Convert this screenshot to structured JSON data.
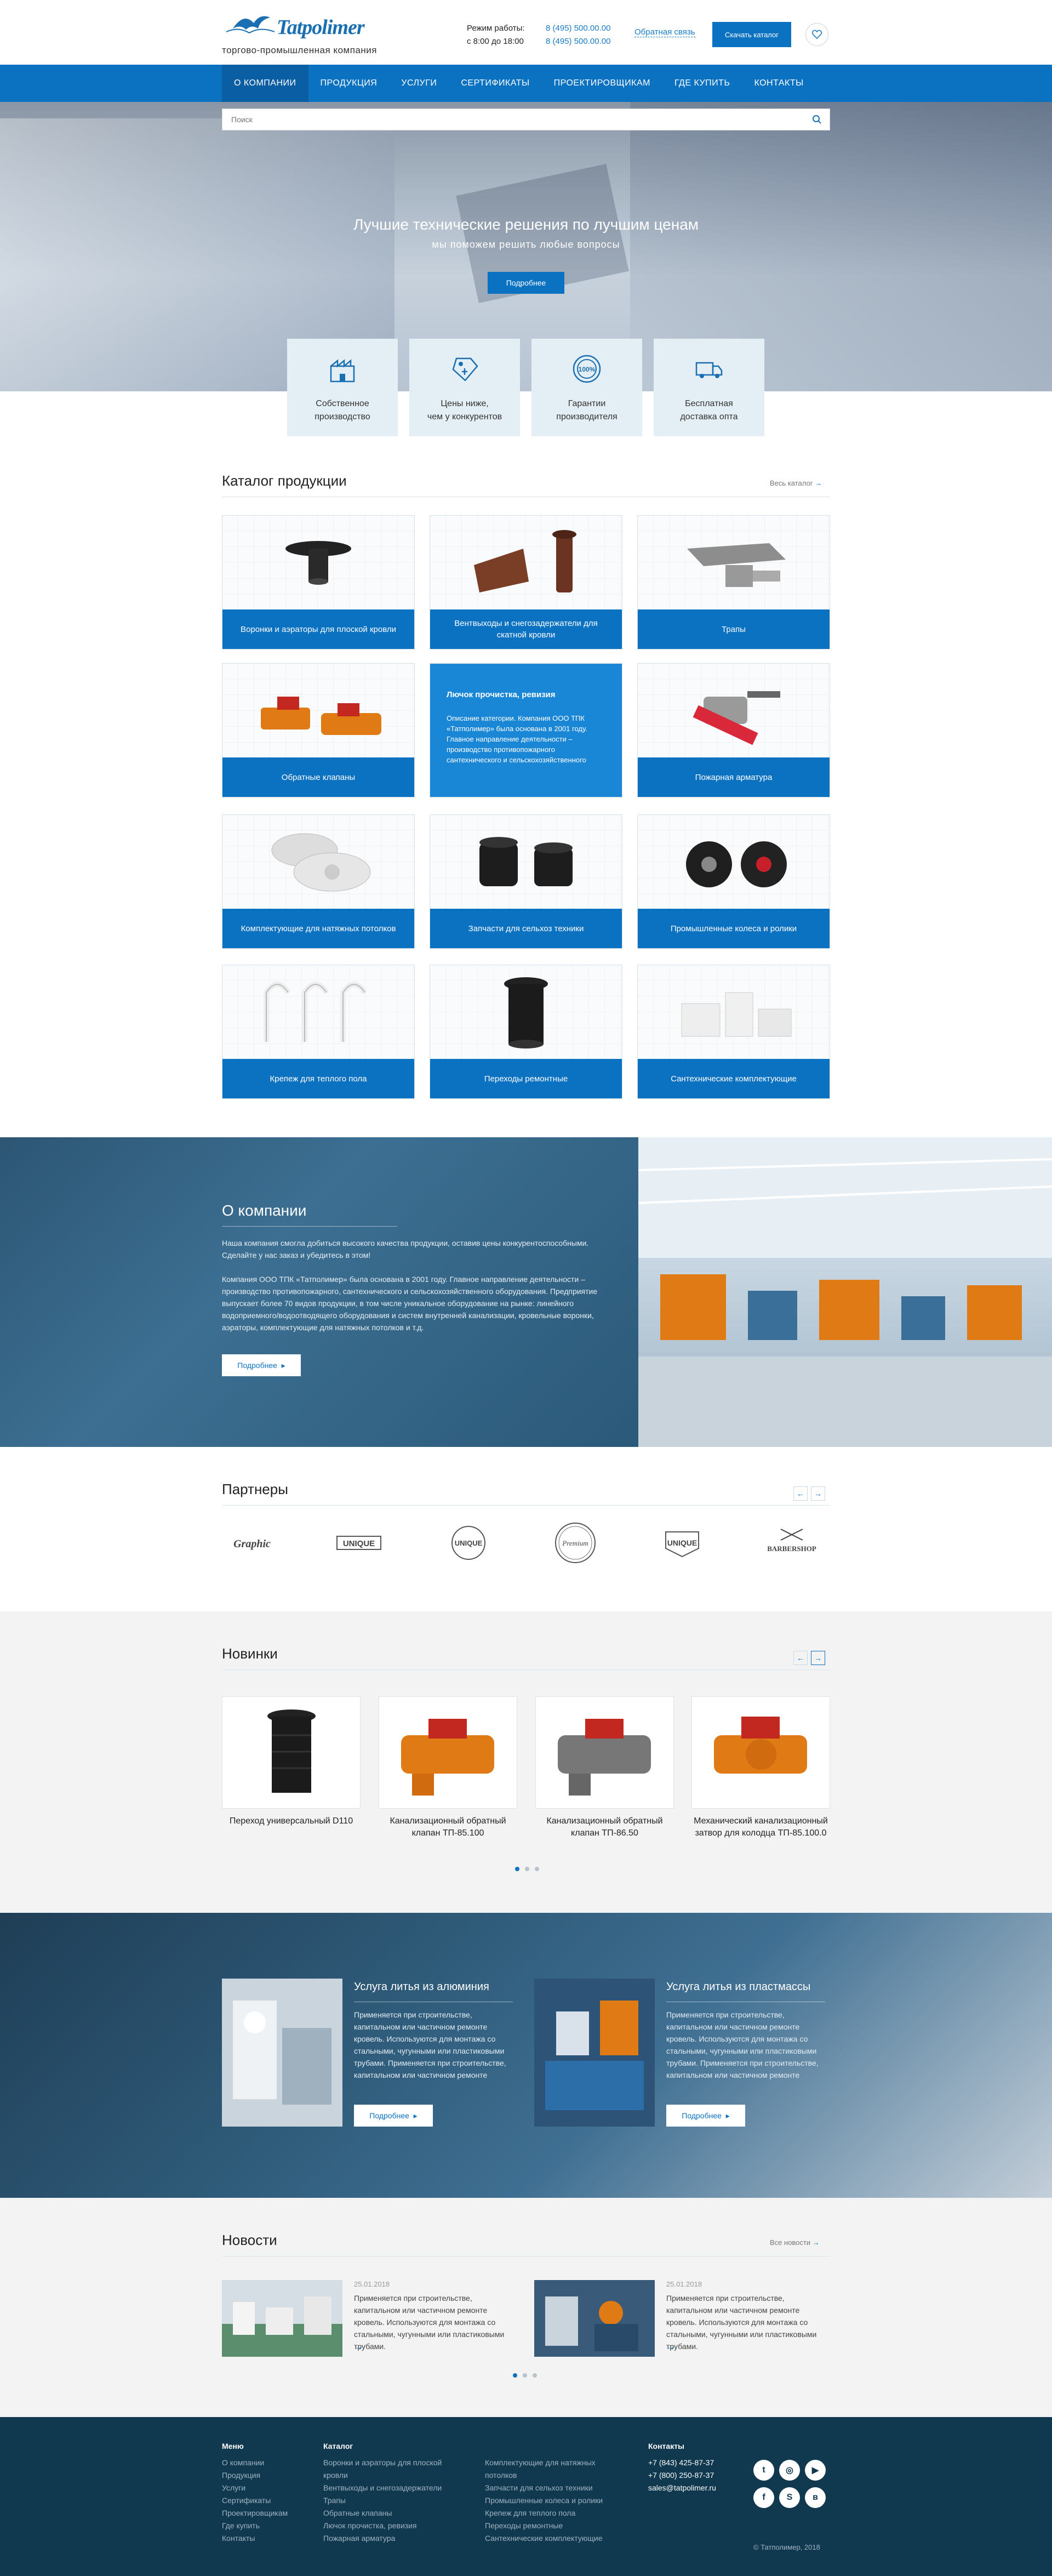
{
  "header": {
    "logo_text": "Tatpolimer",
    "tagline": "торгово-промышленная компания",
    "hours_label_1": "Режим работы:",
    "hours_label_2": "с 8:00 до 18:00",
    "phone_1": "8 (495) 500.00.00",
    "phone_2": "8 (495) 500.00.00",
    "callback": "Обратная связь",
    "catalog_button": "Скачать каталог",
    "cart_icon": "heart-cart-icon"
  },
  "nav": {
    "items": [
      "О КОМПАНИИ",
      "ПРОДУКЦИЯ",
      "УСЛУГИ",
      "СЕРТИФИКАТЫ",
      "ПРОЕКТИРОВЩИКАМ",
      "ГДЕ КУПИТЬ",
      "КОНТАКТЫ"
    ]
  },
  "search": {
    "placeholder": "Поиск"
  },
  "hero": {
    "title": "Лучшие технические решения по лучшим ценам",
    "subtitle": "мы поможем решить любые вопросы",
    "button": "Подробнее"
  },
  "features": [
    {
      "line1": "Собственное",
      "line2": "производство",
      "icon": "factory-icon"
    },
    {
      "line1": "Цены ниже,",
      "line2": "чем у конкурентов",
      "icon": "price-tag-icon"
    },
    {
      "line1": "Гарантии",
      "line2": "производителя",
      "icon": "guarantee-badge-icon"
    },
    {
      "line1": "Бесплатная",
      "line2": "доставка опта",
      "icon": "delivery-truck-icon"
    }
  ],
  "catalog": {
    "title": "Каталог продукции",
    "all_link": "Весь каталог",
    "items": [
      "Воронки и аэраторы для плоской кровли",
      "Вентвыходы и снегозадержатели для скатной кровли",
      "Трапы",
      "Обратные клапаны",
      "Лючок прочистка, ревизия",
      "Пожарная арматура",
      "Комплектующие для натяжных потолков",
      "Запчасти для сельхоз техники",
      "Промышленные колеса и ролики",
      "Крепеж для теплого пола",
      "Переходы ремонтные",
      "Сантехнические комплектующие"
    ],
    "highlight_text": "Описание категории. Компания ООО ТПК «Татполимер» была основана в 2001 году. Главное направление деятельности – производство противопожарного сантехнического и сельскохозяйственного"
  },
  "about": {
    "title": "О компании",
    "p1": "Наша компания смогла добиться высокого качества продукции, оставив цены конкурентоспособными. Сделайте у нас заказ и убедитесь в этом!",
    "p2": "Компания ООО ТПК «Татполимер» была основана в 2001 году. Главное направление деятельности – производство противопожарного, сантехнического и сельскохозяйственного оборудования. Предприятие выпускает более 70 видов продукции, в том числе уникальное оборудование на рынке: линейного водоприемного/водоотводящего оборудования и систем внутренней канализации, кровельные воронки, аэраторы, комплектующие для натяжных потолков и т.д.",
    "button": "Подробнее"
  },
  "partners": {
    "title": "Партнеры",
    "logos": [
      "Graphic",
      "UNIQUE",
      "UNIQUE",
      "Premium",
      "UNIQUE",
      "BARBERSHOP"
    ]
  },
  "novinki": {
    "title": "Новинки",
    "items": [
      {
        "l1": "Переход универсальный D110",
        "l2": ""
      },
      {
        "l1": "Канализационный обратный",
        "l2": "клапан ТП-85.100"
      },
      {
        "l1": "Канализационный обратный",
        "l2": "клапан ТП-86.50"
      },
      {
        "l1": "Механический канализационный",
        "l2": "затвор для колодца ТП-85.100.0"
      }
    ]
  },
  "services": [
    {
      "title": "Услуга литья из алюминия",
      "text": "Применяется при строительстве, капитальном или частичном ремонте кровель. Используются для монтажа со стальными, чугунными или пластиковыми трубами. Применяется при строительстве, капитальном или частичном ремонте",
      "button": "Подробнее"
    },
    {
      "title": "Услуга литья из пластмассы",
      "text": "Применяется при строительстве, капитальном или частичном ремонте кровель. Используются для монтажа со стальными, чугунными или пластиковыми трубами. Применяется при строительстве, капитальном или частичном ремонте",
      "button": "Подробнее"
    }
  ],
  "news": {
    "title": "Новости",
    "all_link": "Все новости",
    "items": [
      {
        "date": "25.01.2018",
        "text": "Применяется при строительстве, капитальном или частичном ремонте кровель. Используются для монтажа со стальными, чугунными или пластиковыми трубами."
      },
      {
        "date": "25.01.2018",
        "text": "Применяется при строительстве, капитальном или частичном ремонте кровель. Используются для монтажа со стальными, чугунными или пластиковыми трубами."
      }
    ]
  },
  "footer": {
    "menu_title": "Меню",
    "menu": [
      "О компании",
      "Продукция",
      "Услуги",
      "Сертификаты",
      "Проектировщикам",
      "Где купить",
      "Контакты"
    ],
    "catalog_title": "Каталог",
    "catalog_col1": [
      "Воронки и аэраторы для плоской",
      "кровли",
      "Вентвыходы и снегозадержатели",
      "Трапы",
      "Обратные клапаны",
      "Лючок прочистка, ревизия",
      "Пожарная арматура"
    ],
    "catalog_col2": [
      "Комплектующие для натяжных",
      "потолков",
      "Запчасти для сельхоз техники",
      "Промышленные колеса и ролики",
      "Крепеж для теплого пола",
      "Переходы ремонтные",
      "Сантехнические комплектующие"
    ],
    "contacts_title": "Контакты",
    "phone_1": "+7 (843) 425-87-37",
    "phone_2": "+7 (800) 250-87-37",
    "email": "sales@tatpolimer.ru",
    "copyright": "© Татполимер, 2018"
  },
  "colors": {
    "accent": "#0b72c2",
    "footer": "#10394f"
  }
}
